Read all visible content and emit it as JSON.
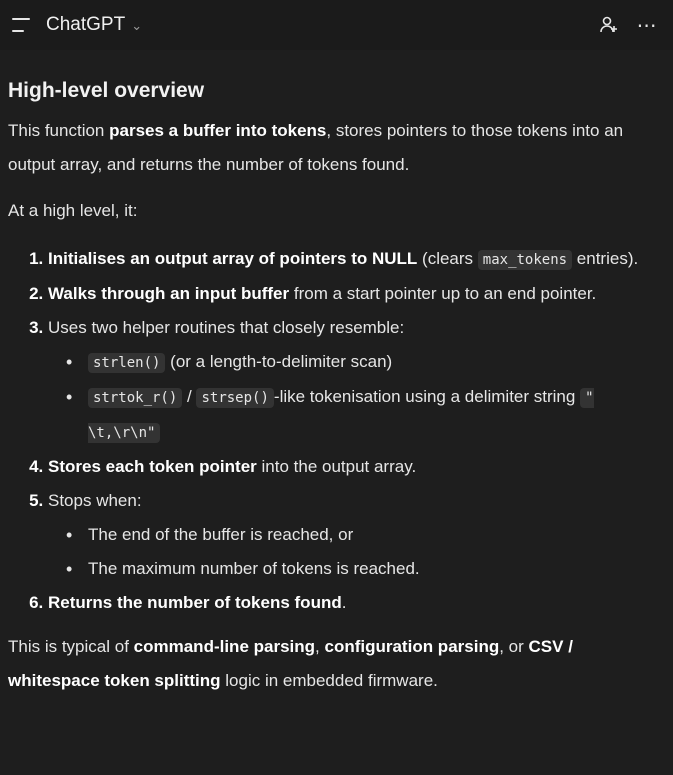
{
  "header": {
    "title": "ChatGPT",
    "chevron": "⌄",
    "more": "⋯"
  },
  "heading": "High-level overview",
  "intro": {
    "pre": "This function ",
    "bold": "parses a buffer into tokens",
    "post": ", stores pointers to those tokens into an output array, and returns the number of tokens found."
  },
  "lead": "At a high level, it:",
  "steps": {
    "s1": {
      "bold": "Initialises an output array of pointers to NULL",
      "mid": " (clears ",
      "code": "max_tokens",
      "post": " entries)."
    },
    "s2": {
      "bold": "Walks through an input buffer",
      "post": " from a start pointer up to an end pointer."
    },
    "s3": {
      "text": "Uses two helper routines that closely resemble:",
      "b1": {
        "code": "strlen()",
        "post": " (or a length-to-delimiter scan)"
      },
      "b2": {
        "code1": "strtok_r()",
        "sep": " / ",
        "code2": "strsep()",
        "post": "-like tokenisation using a delimiter string ",
        "code3": "\" \\t,\\r\\n\""
      }
    },
    "s4": {
      "bold": "Stores each token pointer",
      "post": " into the output array."
    },
    "s5": {
      "text": "Stops when:",
      "b1": "The end of the buffer is reached, or",
      "b2": "The maximum number of tokens is reached."
    },
    "s6": {
      "bold": "Returns the number of tokens found",
      "post": "."
    }
  },
  "closing": {
    "pre": "This is typical of ",
    "b1": "command-line parsing",
    "sep1": ", ",
    "b2": "configuration parsing",
    "sep2": ", or ",
    "b3": "CSV / whitespace token splitting",
    "post": " logic in embedded firmware."
  }
}
